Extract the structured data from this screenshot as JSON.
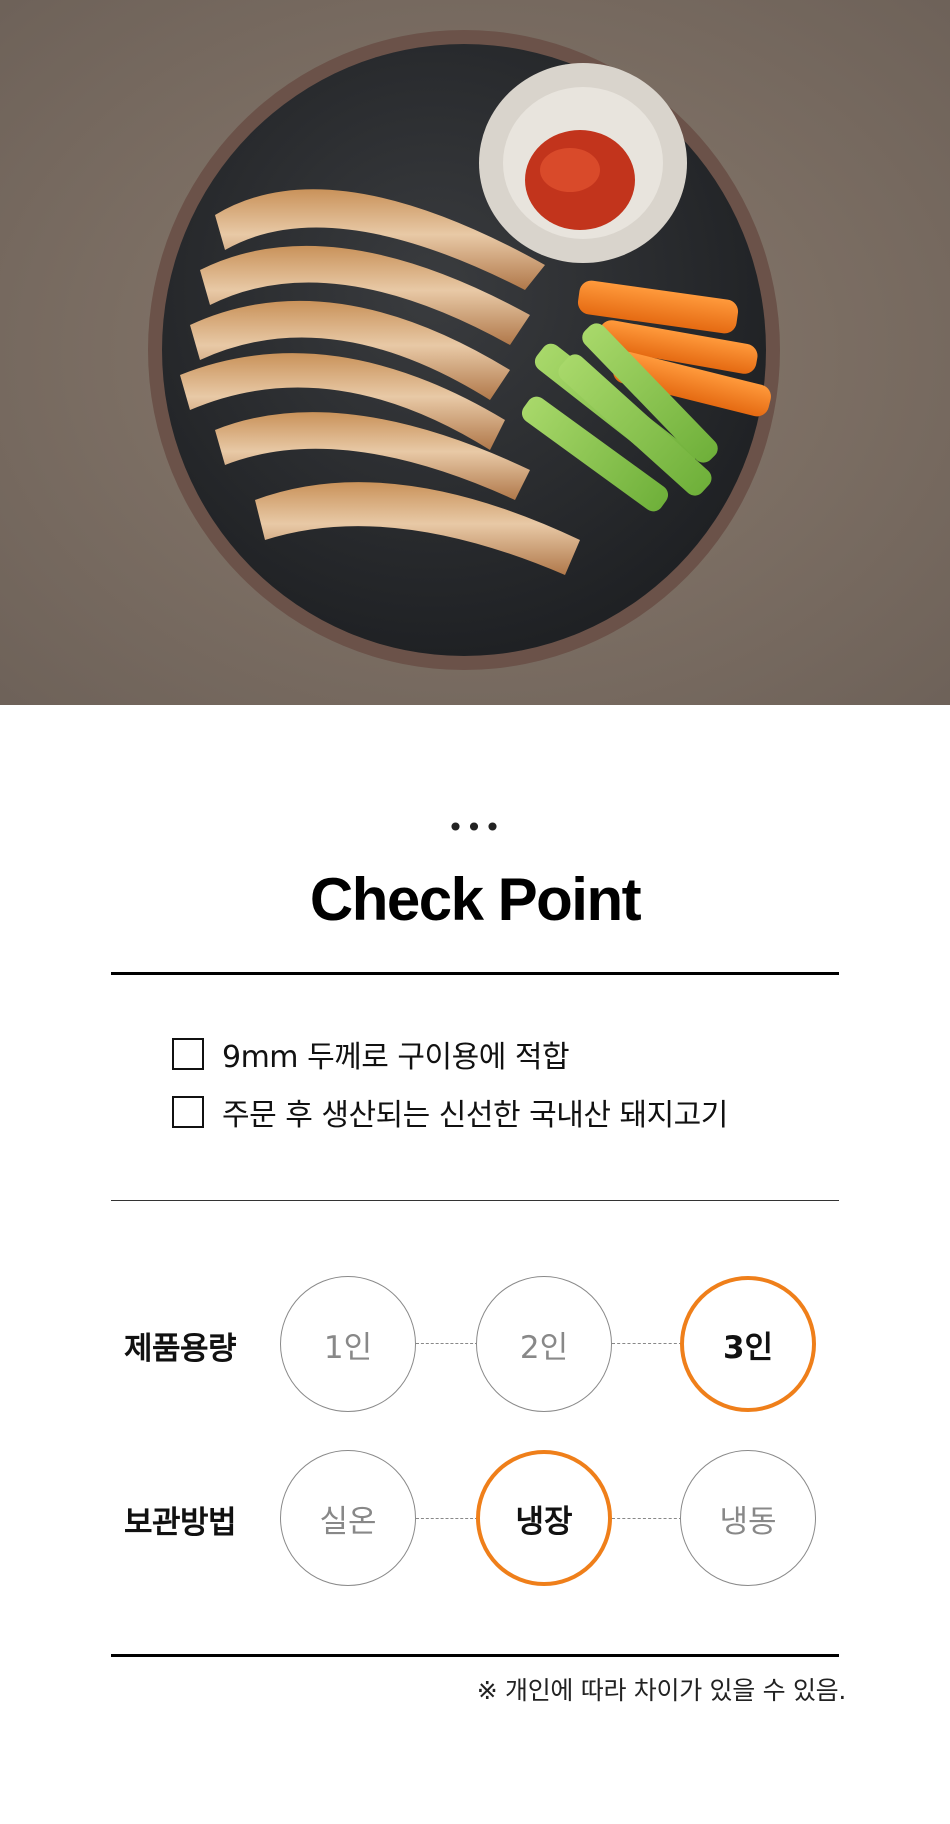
{
  "header": {
    "ellipsis": "•••",
    "title": "Check Point"
  },
  "checklist": [
    {
      "text": "9mm 두께로 구이용에 적합"
    },
    {
      "text": "주문 후 생산되는 신선한 국내산 돼지고기"
    }
  ],
  "options": {
    "capacity": {
      "label": "제품용량",
      "choices": [
        "1인",
        "2인",
        "3인"
      ],
      "selected": "3인"
    },
    "storage": {
      "label": "보관방법",
      "choices": [
        "실온",
        "냉장",
        "냉동"
      ],
      "selected": "냉장"
    }
  },
  "footnote": "※ 개인에 따라 차이가 있을 수 있음.",
  "colors": {
    "accent": "#ef7f1a",
    "text": "#111111",
    "muted": "#888888"
  },
  "hero_image": {
    "icon": "food-photo-grilled-pork-belly"
  }
}
